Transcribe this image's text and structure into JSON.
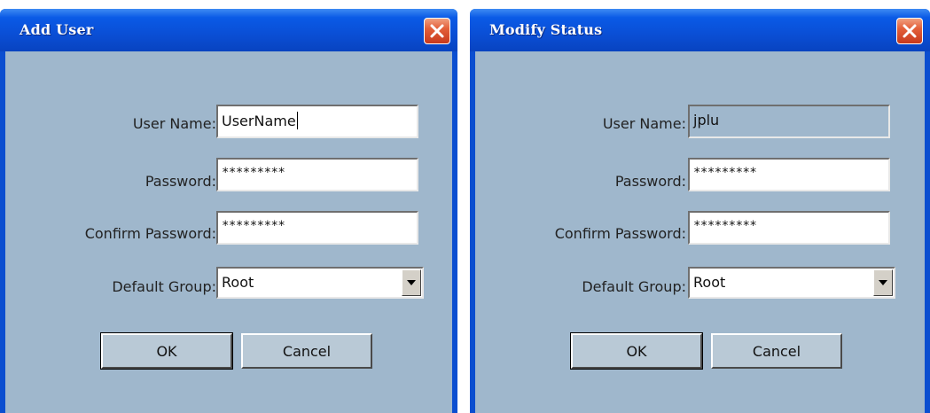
{
  "dialogs": [
    {
      "title": "Add User",
      "labels": {
        "user_name": "User Name:",
        "password": "Password:",
        "confirm_password": "Confirm Password:",
        "default_group": "Default Group:"
      },
      "values": {
        "user_name": "UserName",
        "password": "*********",
        "confirm_password": "*********",
        "default_group": "Root"
      },
      "buttons": {
        "ok": "OK",
        "cancel": "Cancel"
      }
    },
    {
      "title": "Modify Status",
      "labels": {
        "user_name": "User Name:",
        "password": "Password:",
        "confirm_password": "Confirm Password:",
        "default_group": "Default Group:"
      },
      "values": {
        "user_name": "jplu",
        "password": "*********",
        "confirm_password": "*********",
        "default_group": "Root"
      },
      "buttons": {
        "ok": "OK",
        "cancel": "Cancel"
      }
    }
  ],
  "icons": {
    "close": "close-icon",
    "dropdown": "chevron-down-icon"
  },
  "colors": {
    "titlebar": "#0a4fd6",
    "client": "#9fb7cc",
    "close": "#d9502e"
  }
}
